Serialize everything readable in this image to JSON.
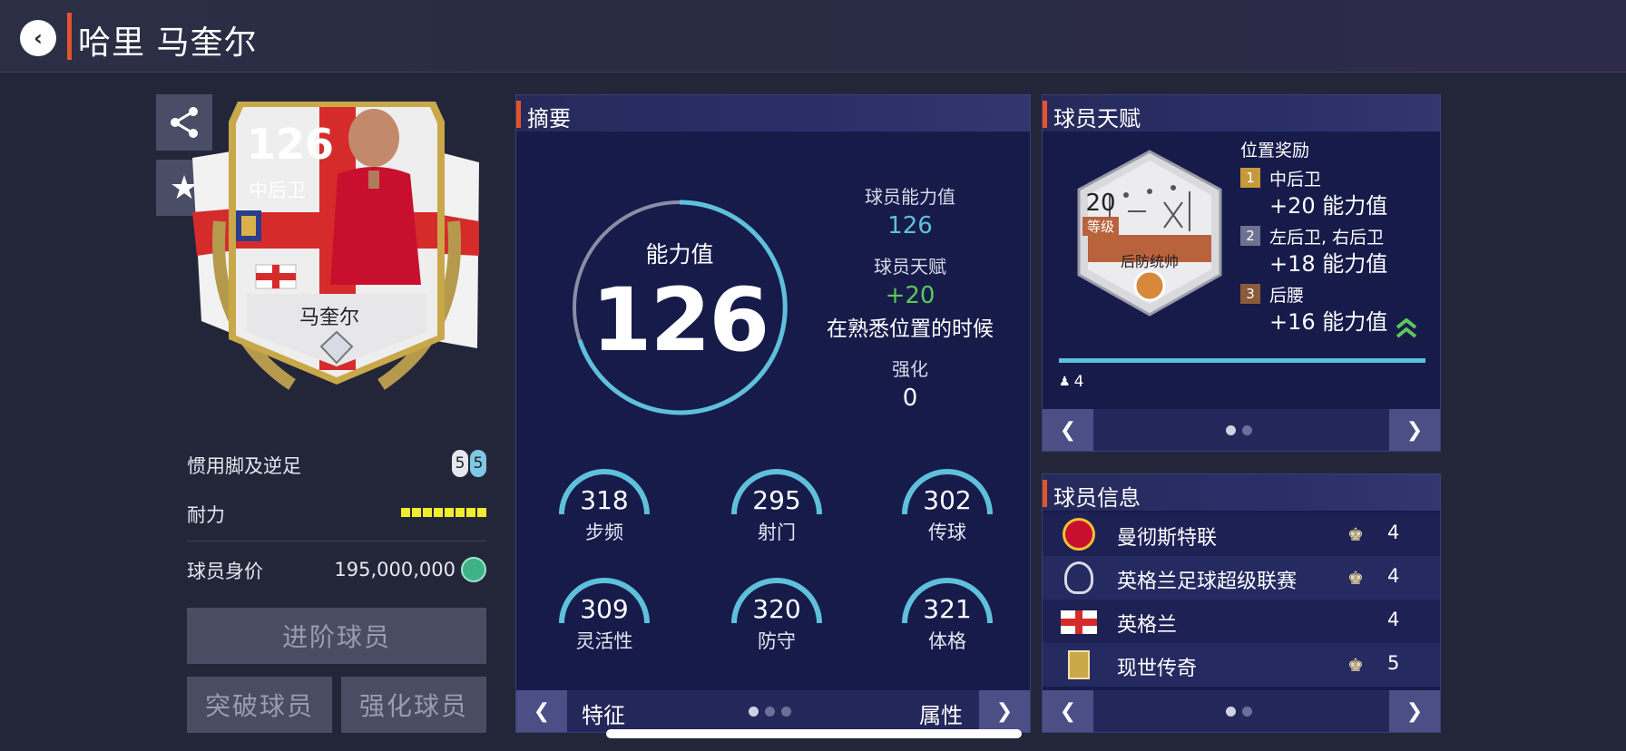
{
  "header": {
    "title": "哈里 马奎尔"
  },
  "card": {
    "rating": "126",
    "position": "中后卫",
    "name": "马奎尔"
  },
  "left": {
    "foot_label": "惯用脚及逆足",
    "foot_left": "5",
    "foot_right": "5",
    "stamina_label": "耐力",
    "stamina_level": 8,
    "value_label": "球员身价",
    "value": "195,000,000",
    "advance_btn": "进阶球员",
    "break_btn": "突破球员",
    "upgrade_btn": "强化球员"
  },
  "summary": {
    "title": "摘要",
    "ovr_label": "能力值",
    "ovr_value": "126",
    "ability_label": "球员能力值",
    "ability_value": "126",
    "talent_label": "球员天赋",
    "talent_value": "+20",
    "talent_note": "在熟悉位置的时候",
    "enhance_label": "强化",
    "enhance_value": "0",
    "stats": [
      {
        "value": "318",
        "label": "步频"
      },
      {
        "value": "295",
        "label": "射门"
      },
      {
        "value": "302",
        "label": "传球"
      },
      {
        "value": "309",
        "label": "灵活性"
      },
      {
        "value": "320",
        "label": "防守"
      },
      {
        "value": "321",
        "label": "体格"
      }
    ],
    "footer_left": "特征",
    "footer_right": "属性",
    "prev_glyph": "❮",
    "next_glyph": "❯"
  },
  "talent": {
    "title": "球员天赋",
    "level": "20",
    "level_label": "等级",
    "badge_name": "后防统帅",
    "bonus_title": "位置奖励",
    "bonuses": [
      {
        "rank": "1",
        "positions": "中后卫",
        "value": "+20 能力值",
        "color": "#c59a3c"
      },
      {
        "rank": "2",
        "positions": "左后卫, 右后卫",
        "value": "+18 能力值",
        "color": "#6f7290"
      },
      {
        "rank": "3",
        "positions": "后腰",
        "value": "+16 能力值",
        "color": "#8b5a3a"
      }
    ],
    "count": "4"
  },
  "info": {
    "title": "球员信息",
    "rows": [
      {
        "name": "曼彻斯特联",
        "num": "4"
      },
      {
        "name": "英格兰足球超级联赛",
        "num": "4"
      },
      {
        "name": "英格兰",
        "num": "4"
      },
      {
        "name": "现世传奇",
        "num": "5"
      }
    ]
  },
  "colors": {
    "accent": "#e3542a",
    "gauge": "#5fc0dc",
    "green": "#5ac85a",
    "stamina": "#f2ec2e"
  }
}
